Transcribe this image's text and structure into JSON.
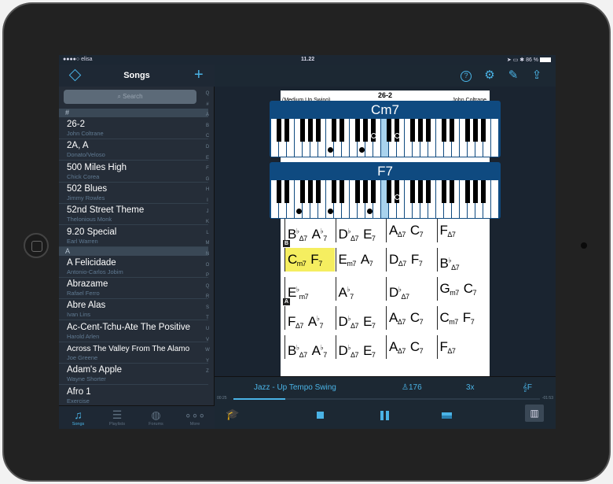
{
  "status": {
    "carrier": "●●●●○ elisa",
    "time": "11.22",
    "battery": "86 %"
  },
  "sidebar": {
    "title": "Songs",
    "search_placeholder": "Search",
    "index": [
      "Q",
      "#",
      "A",
      "B",
      "C",
      "D",
      "E",
      "F",
      "G",
      "H",
      "I",
      "J",
      "K",
      "L",
      "M",
      "N",
      "O",
      "P",
      "Q",
      "R",
      "S",
      "T",
      "U",
      "V",
      "W",
      "Y",
      "Z"
    ],
    "sections": [
      {
        "label": "#",
        "items": [
          {
            "name": "26-2",
            "artist": "John Coltrane"
          },
          {
            "name": "2A, A",
            "artist": "Donato/Veloso"
          },
          {
            "name": "500 Miles High",
            "artist": "Chick Corea"
          },
          {
            "name": "502 Blues",
            "artist": "Jimmy Rowles"
          },
          {
            "name": "52nd Street Theme",
            "artist": "Thelonious Monk"
          },
          {
            "name": "9.20 Special",
            "artist": "Earl Warren"
          }
        ]
      },
      {
        "label": "A",
        "items": [
          {
            "name": "A Felicidade",
            "artist": "Antonio-Carlos Jobim"
          },
          {
            "name": "Abrazame",
            "artist": "Rafael Ferro"
          },
          {
            "name": "Abre Alas",
            "artist": "Ivan Lins"
          },
          {
            "name": "Ac-Cent-Tchu-Ate The Positive",
            "artist": "Harold Arlen"
          },
          {
            "name": "Across The Valley From The Alamo",
            "artist": "Joe Greene"
          },
          {
            "name": "Adam's Apple",
            "artist": "Wayne Shorter"
          },
          {
            "name": "Afro 1",
            "artist": "Exercise"
          }
        ]
      }
    ],
    "tabs": [
      {
        "label": "Songs",
        "icon": "music-note-icon",
        "active": true
      },
      {
        "label": "Playlists",
        "icon": "list-icon"
      },
      {
        "label": "Forums",
        "icon": "globe-icon"
      },
      {
        "label": "More",
        "icon": "more-icon"
      }
    ]
  },
  "toolbar": {
    "icons": [
      "help-icon",
      "gear-icon",
      "pencil-icon",
      "share-icon"
    ]
  },
  "sheet": {
    "title": "26-2",
    "style": "(Medium Up Swing)",
    "composer": "John Coltrane",
    "rows": [
      {
        "mark": "",
        "bars": [
          [
            [
              "B",
              "♭",
              "Δ7"
            ],
            [
              "A",
              "♭",
              "7"
            ]
          ],
          [
            [
              "D",
              "♭",
              "Δ7"
            ],
            [
              "E",
              "",
              "7"
            ]
          ],
          [
            [
              "A",
              "",
              "Δ7"
            ],
            [
              "C",
              "",
              "7"
            ]
          ],
          [
            [
              "F",
              "",
              "Δ7"
            ]
          ]
        ]
      },
      {
        "mark": "B",
        "bars": [
          [
            [
              "C",
              "",
              "m7"
            ],
            [
              "F",
              "",
              "7"
            ]
          ],
          [
            [
              "E",
              "",
              "m7"
            ],
            [
              "A",
              "",
              "7"
            ]
          ],
          [
            [
              "D",
              "",
              "Δ7"
            ],
            [
              "F",
              "",
              "7"
            ]
          ],
          [
            [
              "B",
              "♭",
              "Δ7"
            ]
          ]
        ]
      },
      {
        "mark": "",
        "bars": [
          [
            [
              "E",
              "♭",
              "m7"
            ]
          ],
          [
            [
              "A",
              "♭",
              "7"
            ]
          ],
          [
            [
              "D",
              "♭",
              "Δ7"
            ]
          ],
          [
            [
              "G",
              "",
              "m7"
            ],
            [
              "C",
              "",
              "7"
            ]
          ]
        ]
      },
      {
        "mark": "A",
        "bars": [
          [
            [
              "F",
              "",
              "Δ7"
            ],
            [
              "A",
              "♭",
              "7"
            ]
          ],
          [
            [
              "D",
              "♭",
              "Δ7"
            ],
            [
              "E",
              "",
              "7"
            ]
          ],
          [
            [
              "A",
              "",
              "Δ7"
            ],
            [
              "C",
              "",
              "7"
            ]
          ],
          [
            [
              "C",
              "",
              "m7"
            ],
            [
              "F",
              "",
              "7"
            ]
          ]
        ]
      },
      {
        "mark": "",
        "bars": [
          [
            [
              "B",
              "♭",
              "Δ7"
            ],
            [
              "A",
              "♭",
              "7"
            ]
          ],
          [
            [
              "D",
              "♭",
              "Δ7"
            ],
            [
              "E",
              "",
              "7"
            ]
          ],
          [
            [
              "A",
              "",
              "Δ7"
            ],
            [
              "C",
              "",
              "7"
            ]
          ],
          [
            [
              "F",
              "",
              "Δ7"
            ]
          ]
        ]
      }
    ],
    "highlight": {
      "row": 1,
      "bar": 0
    }
  },
  "pianos": [
    {
      "chord": "Cm7",
      "notes_semitones_from_low_C": [
        12,
        19,
        22,
        27
      ]
    },
    {
      "chord": "F7",
      "notes_semitones_from_low_C": [
        5,
        12,
        21,
        27
      ]
    }
  ],
  "piano_highlight_semitone": 24,
  "player": {
    "style": "Jazz - Up Tempo Swing",
    "tempo": "176",
    "repeats": "3x",
    "key": "F",
    "elapsed": "00:25",
    "remaining": "-01:53",
    "progress": 0.17
  },
  "colors": {
    "accent": "#4ab3e6",
    "piano_header": "#0f4a80",
    "highlight": "#f5ee60"
  }
}
